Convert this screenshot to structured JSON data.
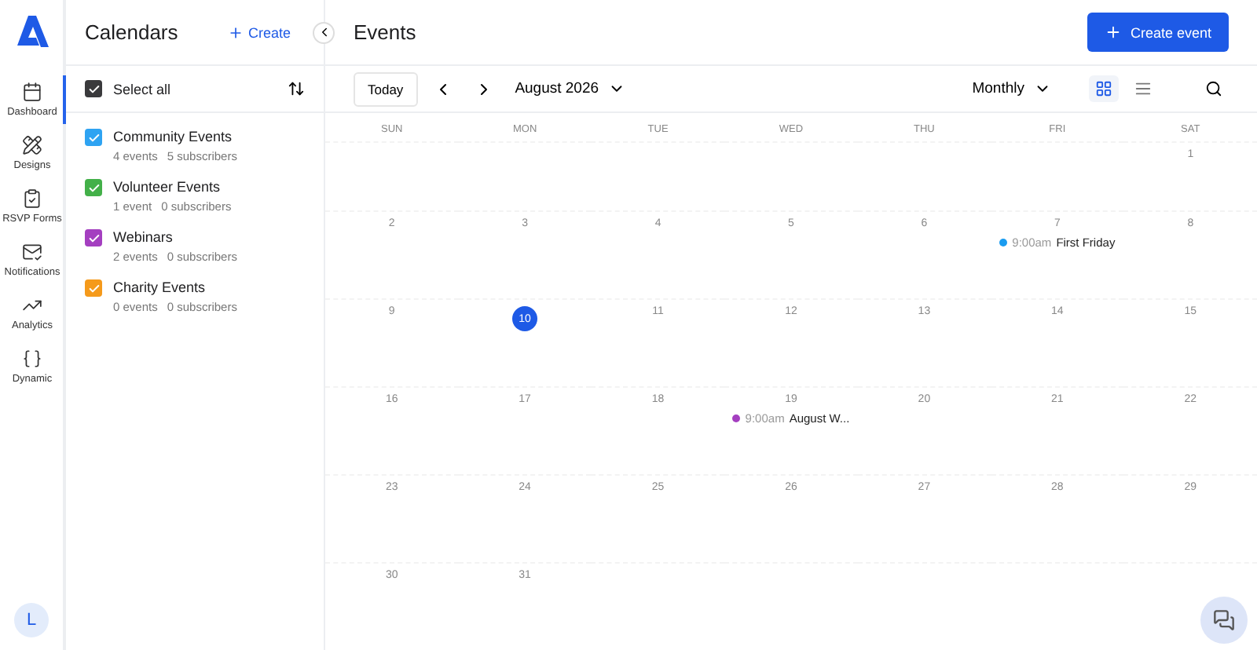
{
  "nav": {
    "items": [
      {
        "kind": "dashboard",
        "label": "Dashboard",
        "selected": true
      },
      {
        "kind": "designs",
        "label": "Designs",
        "selected": false
      },
      {
        "kind": "forms",
        "label": "RSVP Forms",
        "selected": false
      },
      {
        "kind": "notifications",
        "label": "Notifications",
        "selected": false
      },
      {
        "kind": "analytics",
        "label": "Analytics",
        "selected": false
      },
      {
        "kind": "dynamic",
        "label": "Dynamic",
        "selected": false
      }
    ],
    "avatar": "L"
  },
  "calendars": {
    "title": "Calendars",
    "create": "Create",
    "select_all": {
      "label": "Select all",
      "checked": true
    },
    "items": [
      {
        "name": "Community Events",
        "events": "4 events",
        "subscribers": "5 subscribers",
        "checked": true,
        "color": "#2ea3f2"
      },
      {
        "name": "Volunteer Events",
        "events": "1 event",
        "subscribers": "0 subscribers",
        "checked": true,
        "color": "#43b049"
      },
      {
        "name": "Webinars",
        "events": "2 events",
        "subscribers": "0 subscribers",
        "checked": true,
        "color": "#a43fc0"
      },
      {
        "name": "Charity Events",
        "events": "0 events",
        "subscribers": "0 subscribers",
        "checked": true,
        "color": "#f59a1b"
      }
    ]
  },
  "main": {
    "title": "Events",
    "create_button": "Create event",
    "today": "Today",
    "month": "August 2026",
    "mode": "Monthly",
    "views": [
      {
        "kind": "grid",
        "selected": true
      },
      {
        "kind": "list",
        "selected": false
      }
    ],
    "weekdays": [
      "SUN",
      "MON",
      "TUE",
      "WED",
      "THU",
      "FRI",
      "SAT"
    ],
    "weeks": [
      [
        {
          "day": "1",
          "today": false
        }
      ],
      [
        {
          "day": "2",
          "today": false
        },
        {
          "day": "3",
          "today": false
        },
        {
          "day": "4",
          "today": false
        },
        {
          "day": "5",
          "today": false
        },
        {
          "day": "6",
          "today": false
        },
        {
          "day": "7",
          "today": false,
          "events": [
            {
              "time": "9:00am",
              "title": "First Friday",
              "color": "#1a9cf0"
            }
          ]
        },
        {
          "day": "8",
          "today": false
        }
      ],
      [
        {
          "day": "9",
          "today": false
        },
        {
          "day": "10",
          "today": true
        },
        {
          "day": "11",
          "today": false
        },
        {
          "day": "12",
          "today": false
        },
        {
          "day": "13",
          "today": false
        },
        {
          "day": "14",
          "today": false
        },
        {
          "day": "15",
          "today": false
        }
      ],
      [
        {
          "day": "16",
          "today": false
        },
        {
          "day": "17",
          "today": false
        },
        {
          "day": "18",
          "today": false
        },
        {
          "day": "19",
          "today": false,
          "events": [
            {
              "time": "9:00am",
              "title": "August W...",
              "color": "#a43fc0"
            }
          ]
        },
        {
          "day": "20",
          "today": false
        },
        {
          "day": "21",
          "today": false
        },
        {
          "day": "22",
          "today": false
        }
      ],
      [
        {
          "day": "23",
          "today": false
        },
        {
          "day": "24",
          "today": false
        },
        {
          "day": "25",
          "today": false
        },
        {
          "day": "26",
          "today": false
        },
        {
          "day": "27",
          "today": false
        },
        {
          "day": "28",
          "today": false
        },
        {
          "day": "29",
          "today": false
        }
      ],
      [
        {
          "day": "30",
          "today": false
        },
        {
          "day": "31",
          "today": false
        }
      ]
    ]
  }
}
